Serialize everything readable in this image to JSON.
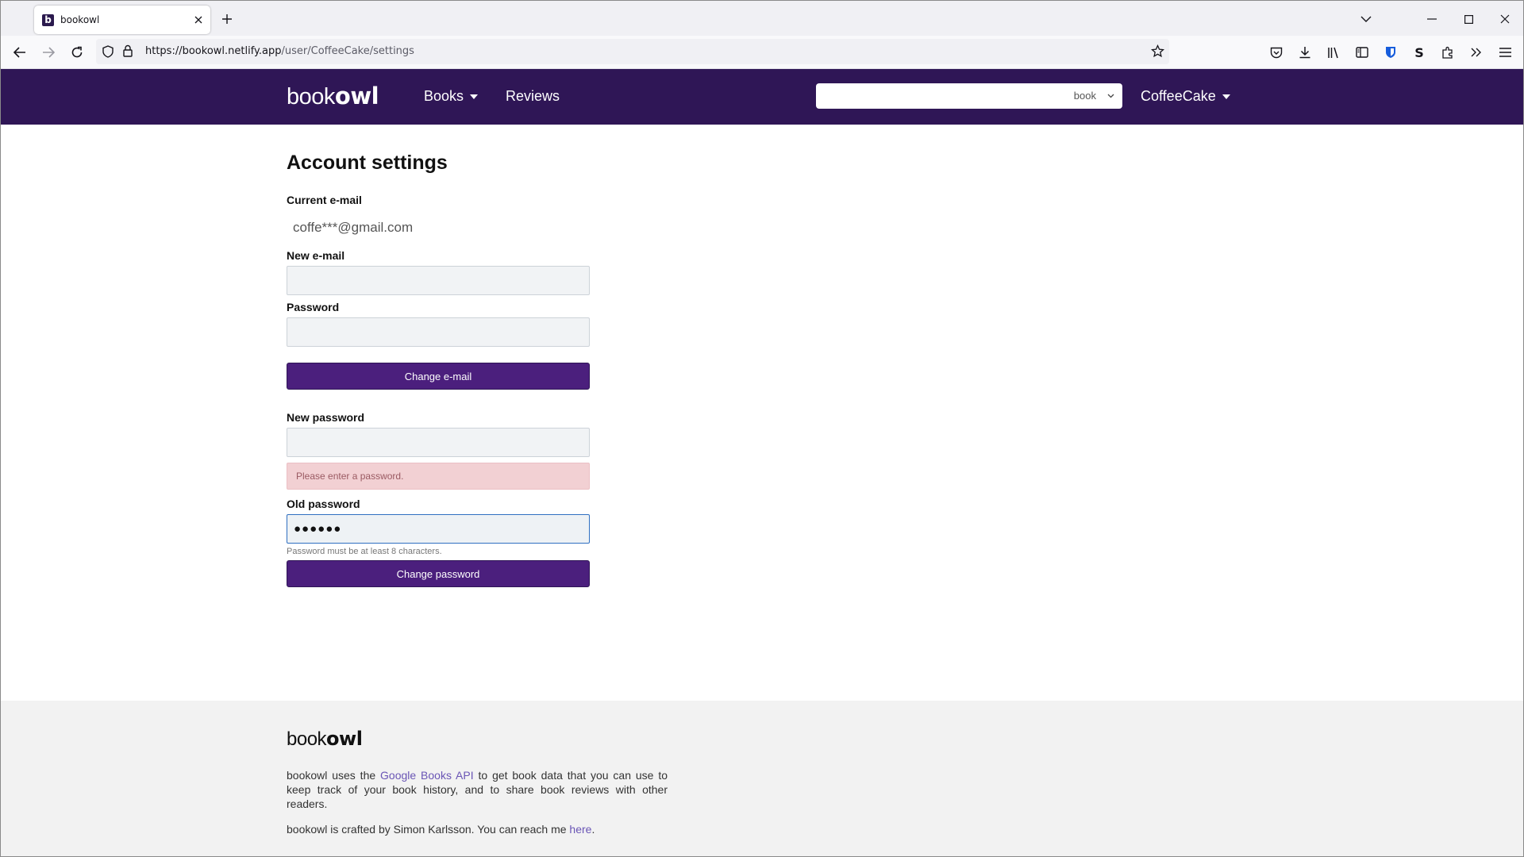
{
  "browser": {
    "tab_title": "bookowl",
    "tab_favicon": "b",
    "url_host": "https://bookowl.netlify.app",
    "url_path": "/user/CoffeeCake/settings"
  },
  "header": {
    "logo_book": "book",
    "logo_owl": "owl",
    "nav_books": "Books",
    "nav_reviews": "Reviews",
    "search_value": "",
    "search_type": "book",
    "username": "CoffeeCake"
  },
  "settings": {
    "title": "Account settings",
    "current_email_label": "Current e-mail",
    "current_email_value": "coffe***@gmail.com",
    "new_email_label": "New e-mail",
    "password_label": "Password",
    "change_email_button": "Change e-mail",
    "new_password_label": "New password",
    "new_password_error": "Please enter a password.",
    "old_password_label": "Old password",
    "old_password_value": "●●●●●●",
    "password_help": "Password must be at least 8 characters.",
    "change_password_button": "Change password"
  },
  "footer": {
    "logo_book": "book",
    "logo_owl": "owl",
    "text1_pre": "bookowl uses the ",
    "text1_link": "Google Books API",
    "text1_post": " to get book data that you can use to keep track of your book history, and to share book reviews with other readers.",
    "text2_pre": "bookowl is crafted by Simon Karlsson. You can reach me ",
    "text2_link": "here",
    "text2_post": "."
  },
  "colors": {
    "header_bg": "#2f1656",
    "button_bg": "#4b1f7d",
    "error_bg": "#f2d0d3",
    "link": "#6a55b5"
  }
}
